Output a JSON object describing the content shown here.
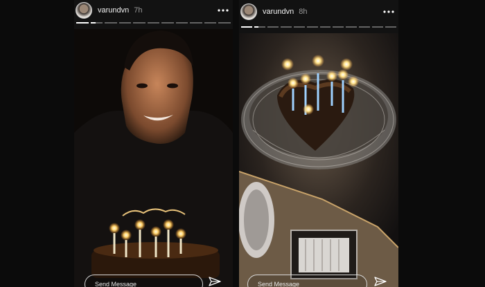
{
  "stories": [
    {
      "username": "varundvn",
      "age": "7h",
      "more_icon": "ellipsis-icon",
      "progress": [
        1,
        0.45,
        0,
        0,
        0,
        0,
        0,
        0,
        0,
        0,
        0
      ],
      "photo": "birthday-portrait-with-cake",
      "cake_topper": "Happy Birthday",
      "reply_placeholder": "Send Message"
    },
    {
      "username": "varundvn",
      "age": "8h",
      "more_icon": "ellipsis-icon",
      "progress": [
        1,
        0.4,
        0,
        0,
        0,
        0,
        0,
        0,
        0,
        0,
        0,
        0
      ],
      "photo": "heart-cake-on-glass-plate",
      "reply_placeholder": "Send Message"
    }
  ],
  "colors": {
    "background": "#0b0b0b",
    "text": "#f2f2f2",
    "muted": "#9a9a9a"
  }
}
